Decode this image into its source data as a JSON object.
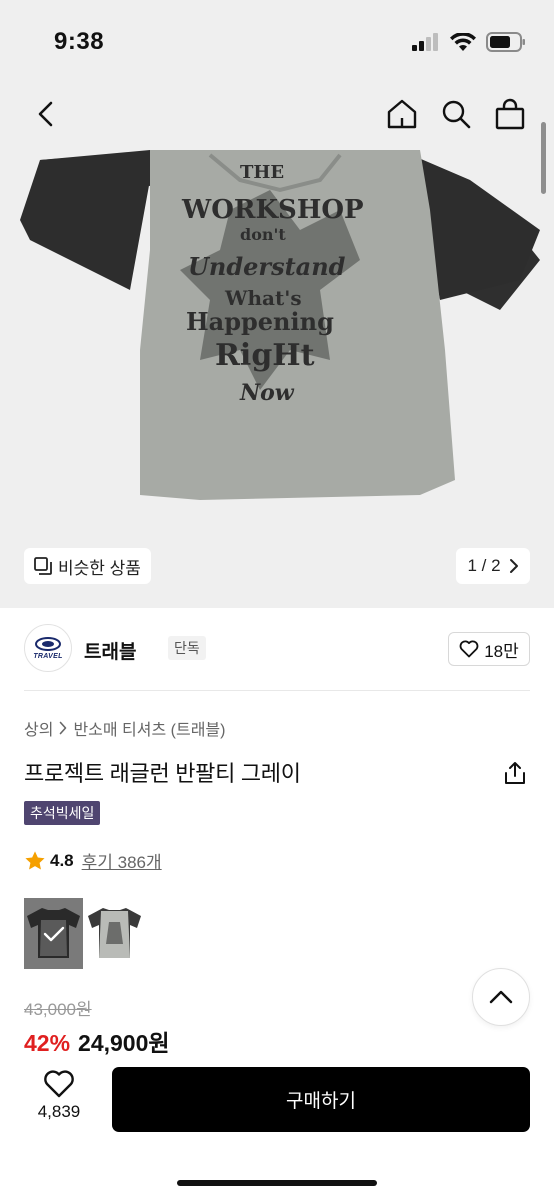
{
  "status_bar": {
    "time": "9:38"
  },
  "hero": {
    "image_icon": "tshirt-raglan-gray-black",
    "similar_label": "비슷한 상품",
    "pager_text": "1 / 2"
  },
  "brand": {
    "name": "트래블",
    "badge": "단독",
    "logo_text": "TRAVEL",
    "likes": "18만"
  },
  "breadcrumb": {
    "category": "상의",
    "subcategory": "반소매 티셔츠 (트래블)"
  },
  "product": {
    "title": "프로젝트 래글런 반팔티 그레이",
    "sale_tag": "추석빅세일",
    "rating": "4.8",
    "reviews": "후기 386개",
    "original_price": "43,000원",
    "discount": "42%",
    "final_price": "24,900원"
  },
  "bottom": {
    "wish_count": "4,839",
    "buy_label": "구매하기"
  },
  "colors": {
    "sale_tag_bg": "#4f4570",
    "discount": "#e02020",
    "star": "#f5a000",
    "buy_bg": "#000000"
  }
}
